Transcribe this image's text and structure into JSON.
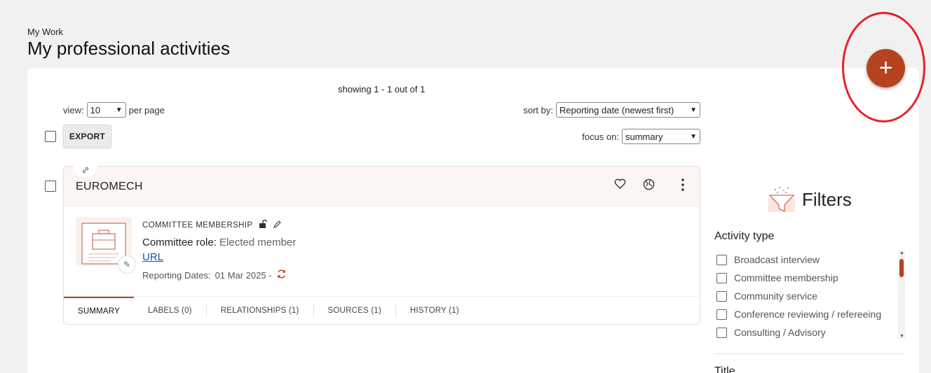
{
  "header": {
    "breadcrumb": "My Work",
    "title": "My professional activities"
  },
  "listing": {
    "showing": "showing 1 - 1 out of 1",
    "view_label": "view:",
    "view_value": "10",
    "per_page_label": "per page",
    "sort_label": "sort by:",
    "sort_value": "Reporting date (newest first)",
    "focus_label": "focus on:",
    "focus_value": "summary",
    "export_label": "EXPORT"
  },
  "activity": {
    "title": "EUROMECH",
    "type": "COMMITTEE MEMBERSHIP",
    "role_label": "Committee role:",
    "role_value": "Elected member",
    "url_label": "URL",
    "dates_label": "Reporting Dates:",
    "dates_value": "01 Mar 2025 -",
    "tabs": [
      {
        "label": "SUMMARY"
      },
      {
        "label": "LABELS (0)"
      },
      {
        "label": "RELATIONSHIPS (1)"
      },
      {
        "label": "SOURCES (1)"
      },
      {
        "label": "HISTORY (1)"
      }
    ]
  },
  "filters": {
    "title": "Filters",
    "activity_type_title": "Activity type",
    "activity_types": [
      {
        "label": "Broadcast interview"
      },
      {
        "label": "Committee membership"
      },
      {
        "label": "Community service"
      },
      {
        "label": "Conference reviewing / refereeing"
      },
      {
        "label": "Consulting / Advisory"
      }
    ],
    "title_group": "Title"
  },
  "fab_label": "+",
  "colors": {
    "accent": "#b5431f",
    "annotation": "#e8202a",
    "link": "#1e4f9c"
  }
}
